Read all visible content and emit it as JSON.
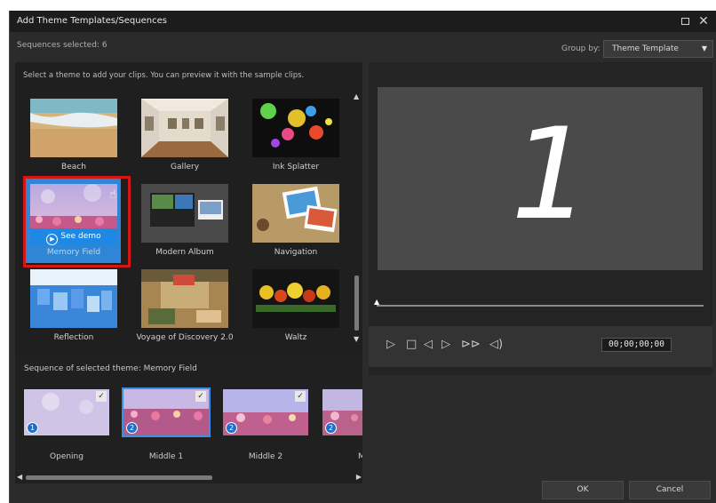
{
  "window": {
    "title": "Add Theme Templates/Sequences"
  },
  "header": {
    "sequences_selected": "Sequences selected: 6",
    "group_by_label": "Group by:",
    "group_by_value": "Theme Template"
  },
  "theme_panel": {
    "instructions": "Select a theme to add your clips. You can preview it with the sample clips.",
    "themes": [
      {
        "label": "Beach"
      },
      {
        "label": "Gallery"
      },
      {
        "label": "Ink Splatter"
      },
      {
        "label": "Memory Field",
        "selected": true,
        "demo_label": "See demo"
      },
      {
        "label": "Modern Album"
      },
      {
        "label": "Navigation"
      },
      {
        "label": "Reflection"
      },
      {
        "label": "Voyage of Discovery 2.0"
      },
      {
        "label": "Waltz"
      }
    ]
  },
  "sequence_panel": {
    "title": "Sequence of selected theme: Memory Field",
    "items": [
      {
        "label": "Opening",
        "badge": "1",
        "checked": true
      },
      {
        "label": "Middle 1",
        "badge": "2",
        "checked": true,
        "selected": true
      },
      {
        "label": "Middle 2",
        "badge": "2",
        "checked": true
      },
      {
        "label": "Mid",
        "badge": "2",
        "checked": false
      }
    ]
  },
  "preview": {
    "frame_number": "1",
    "timecode": "00;00;00;00"
  },
  "buttons": {
    "ok": "OK",
    "cancel": "Cancel"
  },
  "icons": {
    "restore": "restore-window-icon",
    "close": "close-icon",
    "dropdown": "chevron-down-icon",
    "play": "play-icon"
  }
}
